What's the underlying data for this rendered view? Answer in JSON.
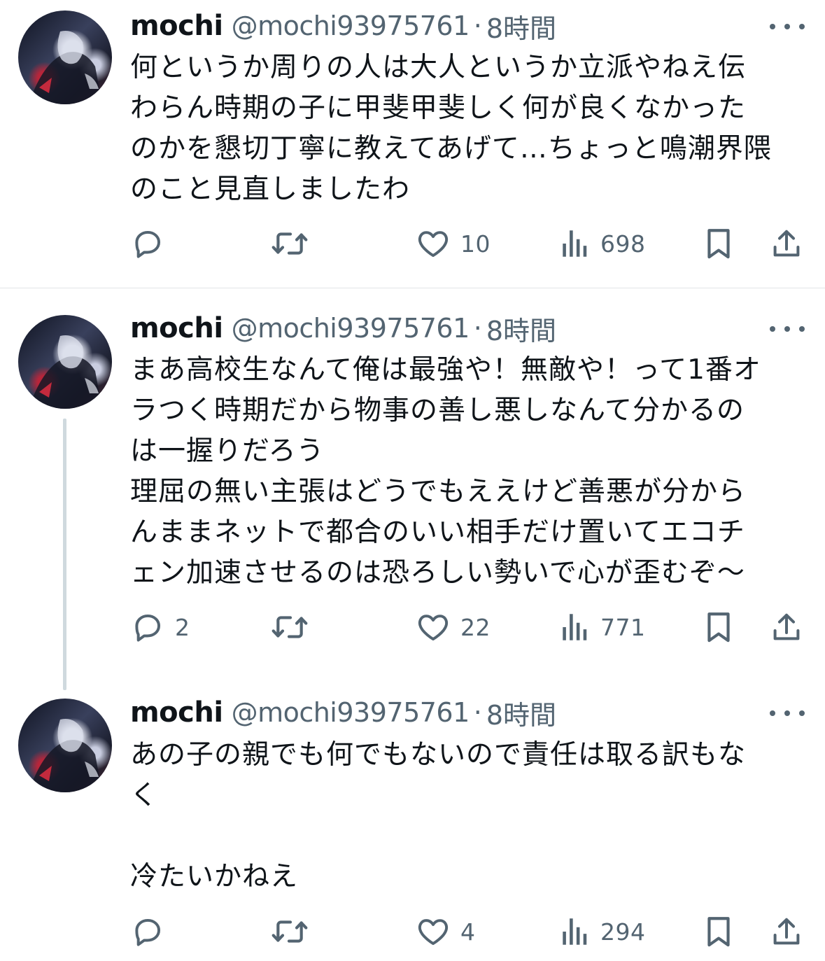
{
  "tweets": [
    {
      "name": "mochi",
      "handle": "@mochi93975761",
      "separator": "·",
      "time": "8時間",
      "lines": [
        "何というか周りの人は大人というか立派やねえ伝",
        "わらん時期の子に甲斐甲斐しく何が良くなかった",
        "のかを懇切丁寧に教えてあげて…ちょっと鳴潮界隈",
        "のこと見直しましたわ"
      ],
      "reply_count": "",
      "retweet_count": "",
      "like_count": "10",
      "view_count": "698"
    },
    {
      "name": "mochi",
      "handle": "@mochi93975761",
      "separator": "·",
      "time": "8時間",
      "lines": [
        "まあ高校生なんて俺は最強や！無敵や！って1番オ",
        "ラつく時期だから物事の善し悪しなんて分かるの",
        "は一握りだろう",
        "理屈の無い主張はどうでもええけど善悪が分から",
        "んままネットで都合のいい相手だけ置いてエコチ",
        "ェン加速させるのは恐ろしい勢いで心が歪むぞ〜"
      ],
      "reply_count": "2",
      "retweet_count": "",
      "like_count": "22",
      "view_count": "771"
    },
    {
      "name": "mochi",
      "handle": "@mochi93975761",
      "separator": "·",
      "time": "8時間",
      "lines": [
        "あの子の親でも何でもないので責任は取る訳もな",
        "く",
        "",
        "冷たいかねえ"
      ],
      "reply_count": "",
      "retweet_count": "",
      "like_count": "4",
      "view_count": "294"
    }
  ],
  "icons": {
    "more": "more-icon",
    "reply": "reply-icon",
    "retweet": "retweet-icon",
    "like": "heart-icon",
    "views": "views-icon",
    "bookmark": "bookmark-icon",
    "share": "share-icon"
  },
  "colors": {
    "text": "#0f1419",
    "secondary": "#536471",
    "divider": "#e1e4e8",
    "thread_line": "#cfd9de"
  }
}
